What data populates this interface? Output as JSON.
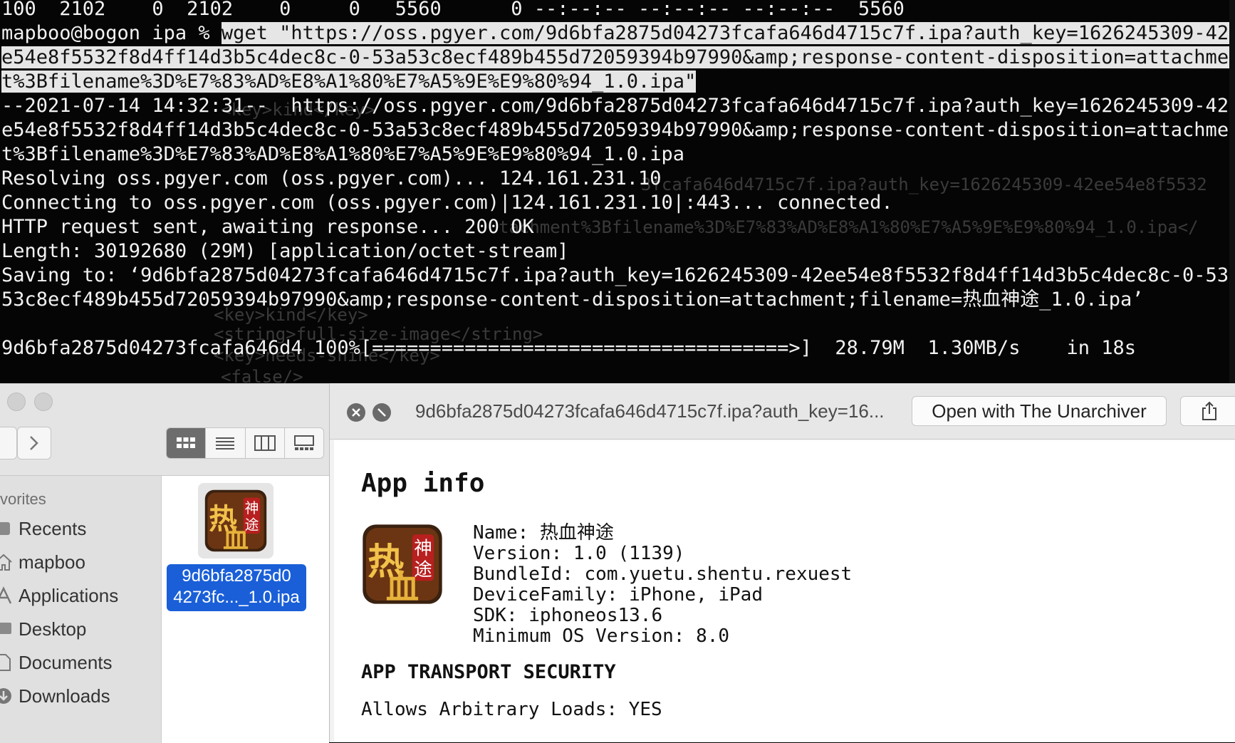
{
  "terminal": {
    "lines": [
      "100  2102    0  2102    0     0   5560      0 --:--:-- --:--:-- --:--:--  5560",
      "e54e8f5532f8d4ff14d3b5c4dec8c-0-53a53c8ecf489b455d72059394b97990&amp;response-content-disposition=attachmen",
      "t%3Bfilename%3D%E7%83%AD%E8%A1%80%E7%A5%9E%E9%80%94_1.0.ipa\"",
      "--2021-07-14 14:32:31--  https://oss.pgyer.com/9d6bfa2875d04273fcafa646d4715c7f.ipa?auth_key=1626245309-42e",
      "e54e8f5532f8d4ff14d3b5c4dec8c-0-53a53c8ecf489b455d72059394b97990&amp;response-content-disposition=attachmen",
      "t%3Bfilename%3D%E7%83%AD%E8%A1%80%E7%A5%9E%E9%80%94_1.0.ipa",
      "Resolving oss.pgyer.com (oss.pgyer.com)... 124.161.231.10",
      "Connecting to oss.pgyer.com (oss.pgyer.com)|124.161.231.10|:443... connected.",
      "HTTP request sent, awaiting response... 200 OK",
      "Length: 30192680 (29M) [application/octet-stream]",
      "Saving to: ‘9d6bfa2875d04273fcafa646d4715c7f.ipa?auth_key=1626245309-42ee54e8f5532f8d4ff14d3b5c4dec8c-0-53a",
      "53c8ecf489b455d72059394b97990&amp;response-content-disposition=attachment;filename=热血神途_1.0.ipa’",
      "",
      "9d6bfa2875d04273fcafa646d4 100%[====================================>]  28.79M  1.30MB/s    in 18s"
    ],
    "prompt": "mapboo@bogon ipa % ",
    "command_part": "wget \"https://oss.pgyer.com/9d6bfa2875d04273fcafa646d4715c7f.ipa?auth_key=1626245309-42e",
    "ghost_lines": [
      "<key>kind</key>",
      "3fcafa646d4715c7f.ipa?auth_key=1626245309-42ee54e8f5532",
      "tachment%3Bfilename%3D%E7%83%AD%E8%A1%80%E7%A5%9E%E9%80%94_1.0.ipa</",
      "<key>kind</key>",
      "<string>full-size-image</string>",
      "<key>needs-shine</key>",
      "<false/>"
    ]
  },
  "finder": {
    "sidebar_heading": "vorites",
    "sidebar_items": [
      "Recents",
      "mapboo",
      "Applications",
      "Desktop",
      "Documents",
      "Downloads"
    ],
    "file_name_line1": "9d6bfa2875d0",
    "file_name_line2": "4273fc..._1.0.ipa"
  },
  "quicklook": {
    "title": "9d6bfa2875d04273fcafa646d4715c7f.ipa?auth_key=16...",
    "open_with_label": "Open with The Unarchiver",
    "app_info_title": "App info",
    "info_lines": [
      "Name: 热血神途",
      "Version: 1.0 (1139)",
      "BundleId: com.yuetu.shentu.rexuest",
      "DeviceFamily: iPhone, iPad",
      "SDK: iphoneos13.6",
      "Minimum OS Version: 8.0"
    ],
    "ats_heading": "APP TRANSPORT SECURITY",
    "ats_line": "Allows Arbitrary Loads: YES"
  },
  "icons": {
    "app_icon_chars": [
      "热",
      "血",
      "神",
      "途"
    ]
  },
  "colors": {
    "terminal_bg": "#050505",
    "selection": "#e6e6e6",
    "finder_selection": "#1a5fd8"
  }
}
